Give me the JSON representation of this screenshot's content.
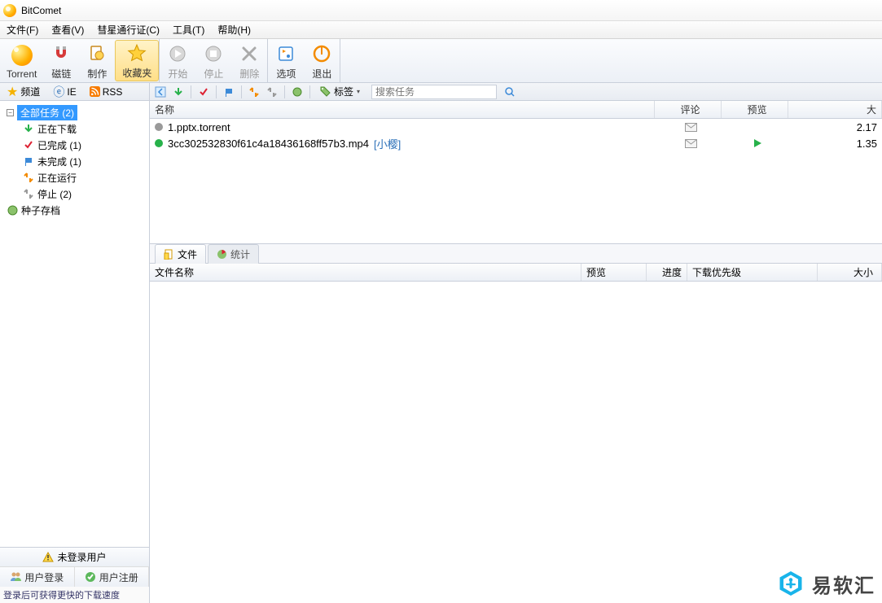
{
  "title": "BitComet",
  "menus": {
    "file": "文件(F)",
    "view": "查看(V)",
    "passport": "彗星通行证(C)",
    "tools": "工具(T)",
    "help": "帮助(H)"
  },
  "toolbar": {
    "torrent": "Torrent",
    "magnet": "磁链",
    "make": "制作",
    "favorite": "收藏夹",
    "start": "开始",
    "stop": "停止",
    "delete": "删除",
    "options": "选项",
    "exit": "退出"
  },
  "sideTabs": {
    "channel": "频道",
    "ie": "IE",
    "rss": "RSS"
  },
  "tree": {
    "allTasks": "全部任务 (2)",
    "downloading": "正在下载",
    "completed": "已完成 (1)",
    "incomplete": "未完成 (1)",
    "running": "正在运行",
    "stopped": "停止 (2)",
    "seedArchive": "种子存档"
  },
  "login": {
    "notLogged": "未登录用户",
    "loginBtn": "用户登录",
    "registerBtn": "用户注册",
    "hint": "登录后可获得更快的下载速度"
  },
  "actionBar": {
    "tagLabel": "标签",
    "searchPlaceholder": "搜索任务"
  },
  "columns": {
    "name": "名称",
    "comment": "评论",
    "preview": "预览",
    "sizeSuffix": "大"
  },
  "tasks": [
    {
      "statusColor": "#9a9a9a",
      "name": "1.pptx.torrent",
      "tag": "",
      "comment": "mail",
      "preview": "",
      "size": "2.17"
    },
    {
      "statusColor": "#27b14a",
      "name": "3cc302532830f61c4a18436168ff57b3.mp4",
      "tag": "[小樱]",
      "comment": "mail",
      "preview": "play",
      "size": "1.35 "
    }
  ],
  "bottomTabs": {
    "files": "文件",
    "stats": "统计"
  },
  "detailCols": {
    "filename": "文件名称",
    "preview": "预览",
    "progress": "进度",
    "priority": "下载优先级",
    "size": "大小"
  },
  "watermark": "易软汇"
}
